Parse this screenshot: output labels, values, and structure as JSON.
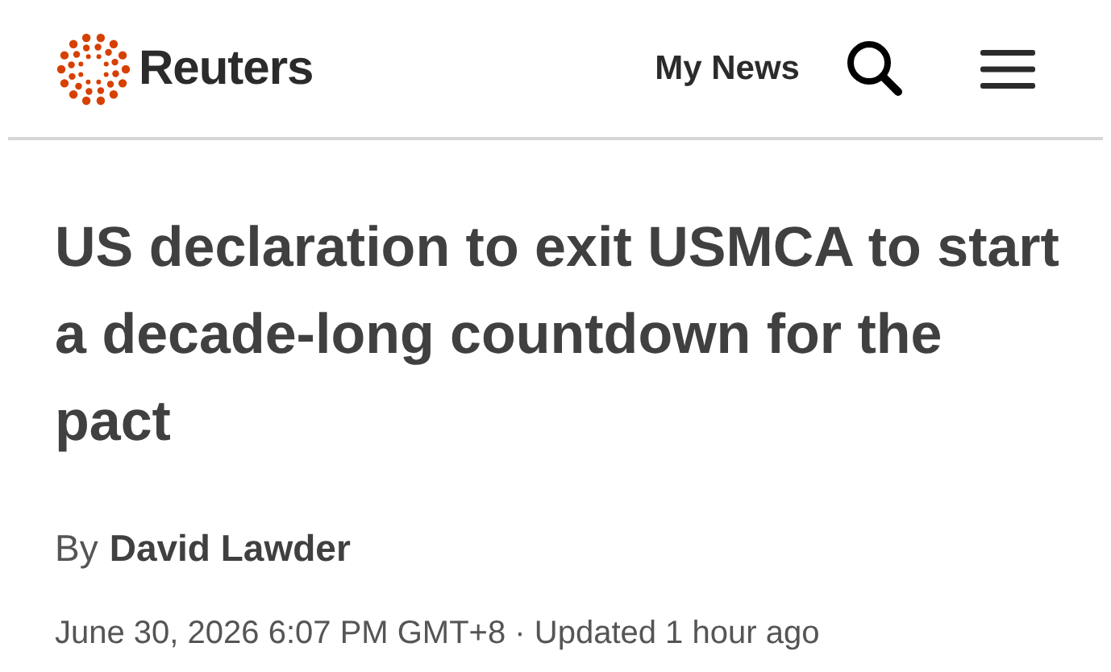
{
  "header": {
    "brand": "Reuters",
    "my_news": "My News"
  },
  "article": {
    "headline": "US declaration to exit USMCA to start a decade-long countdown for the pact",
    "byline_prefix": "By",
    "author": "David Lawder",
    "dateline": "June 30, 2026 6:07 PM GMT+8 · Updated 1 hour ago"
  }
}
